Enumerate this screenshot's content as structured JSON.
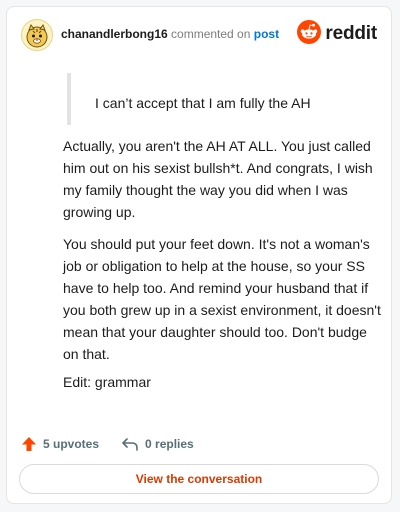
{
  "header": {
    "username": "chanandlerbong16",
    "commented_on": "commented on",
    "post_link": "post",
    "brand": "reddit",
    "avatar_icon": "tiger-avatar-icon",
    "brand_icon": "reddit-alien-icon"
  },
  "comment": {
    "quote": "I can’t accept that I am fully the AH",
    "paragraphs": [
      "Actually, you aren't the AH AT ALL. You just called him out on his sexist bullsh*t. And congrats, I wish my family thought the way you did when I was growing up.",
      "You should put your feet down. It's not a woman's job or obligation to help at the house, so your SS have to help too. And remind your husband that if you both grew up in a sexist environment, it doesn't mean that your daughter should too. Don't budge on that.",
      "Edit: grammar"
    ]
  },
  "actions": {
    "upvotes": "5 upvotes",
    "replies": "0 replies",
    "upvote_icon": "upvote-arrow-icon",
    "reply_icon": "reply-arrow-icon"
  },
  "button": {
    "label": "View the conversation"
  },
  "colors": {
    "reddit_orange": "#ff4500",
    "link_blue": "#0079d3",
    "button_text": "#d93a00",
    "muted": "#576f76"
  }
}
